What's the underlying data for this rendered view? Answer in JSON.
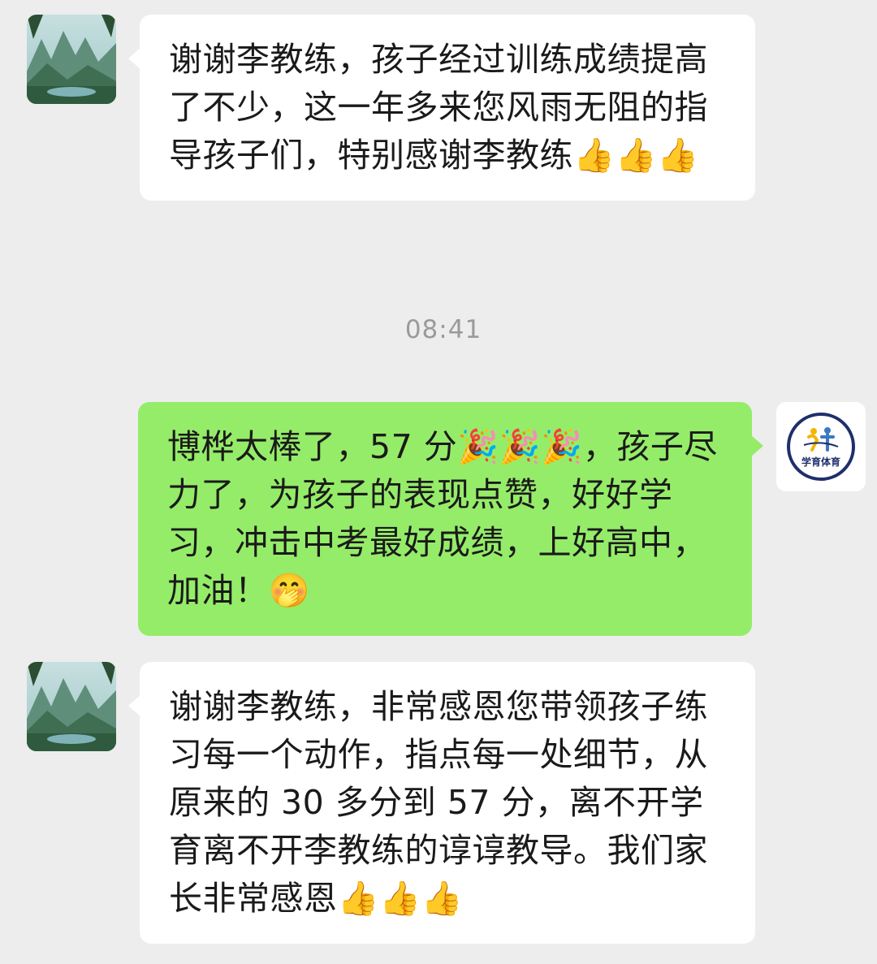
{
  "chat": {
    "timestamp": "08:41",
    "messages": [
      {
        "sender": "parent",
        "text": "谢谢李教练，孩子经过训练成绩提高了不少，这一年多来您风雨无阻的指导孩子们，特别感谢李教练👍👍👍"
      },
      {
        "sender": "coach",
        "text": "博桦太棒了，57 分🎉🎉🎉，孩子尽力了，为孩子的表现点赞，好好学习，冲击中考最好成绩，上好高中，加油！🤭"
      },
      {
        "sender": "parent",
        "text": "谢谢李教练，非常感恩您带领孩子练习每一个动作，指点每一处细节，从原来的 30 多分到 57 分，离不开学育离不开李教练的谆谆教导。我们家长非常感恩👍👍👍"
      }
    ],
    "coach_avatar_label": "学育体育"
  },
  "colors": {
    "background": "#ededed",
    "incoming_bubble": "#ffffff",
    "outgoing_bubble": "#95ec69",
    "timestamp_text": "#9a9a9a"
  },
  "icons": {
    "parent_avatar": "landscape-avatar-icon",
    "coach_avatar": "xueyu-sports-logo-icon"
  }
}
